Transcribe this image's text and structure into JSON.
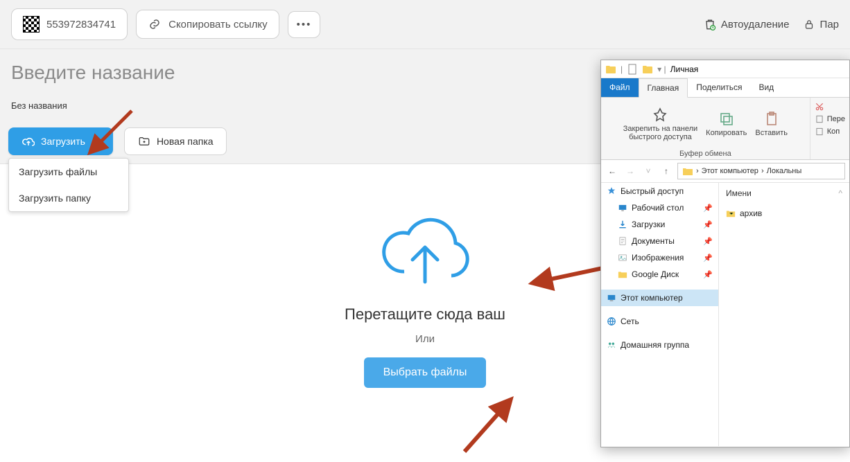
{
  "header": {
    "code": "553972834741",
    "copy_link": "Скопировать ссылку",
    "autodelete": "Автоудаление",
    "password": "Пар"
  },
  "title": {
    "placeholder": "Введите название",
    "subtitle": "Без названия"
  },
  "toolbar": {
    "upload": "Загрузить",
    "new_folder": "Новая папка"
  },
  "dropdown": {
    "upload_files": "Загрузить файлы",
    "upload_folder": "Загрузить папку"
  },
  "dropzone": {
    "heading": "Перетащите сюда ваш",
    "or": "Или",
    "choose": "Выбрать файлы"
  },
  "explorer": {
    "window_title": "Личная",
    "tabs": {
      "file": "Файл",
      "main": "Главная",
      "share": "Поделиться",
      "view": "Вид"
    },
    "ribbon": {
      "pin": "Закрепить на панели\nбыстрого доступа",
      "copy": "Копировать",
      "paste": "Вставить",
      "clipboard_label": "Буфер обмена",
      "side_paste": "Пере",
      "side_copy": "Коп"
    },
    "path": {
      "root": "Этот компьютер",
      "seg": "Локальны"
    },
    "tree": {
      "quick": "Быстрый доступ",
      "desktop": "Рабочий стол",
      "downloads": "Загрузки",
      "documents": "Документы",
      "pictures": "Изображения",
      "gdrive": "Google Диск",
      "thispc": "Этот компьютер",
      "network": "Сеть",
      "homegroup": "Домашняя группа"
    },
    "content": {
      "col_name": "Имени",
      "file_archive": "архив"
    }
  }
}
